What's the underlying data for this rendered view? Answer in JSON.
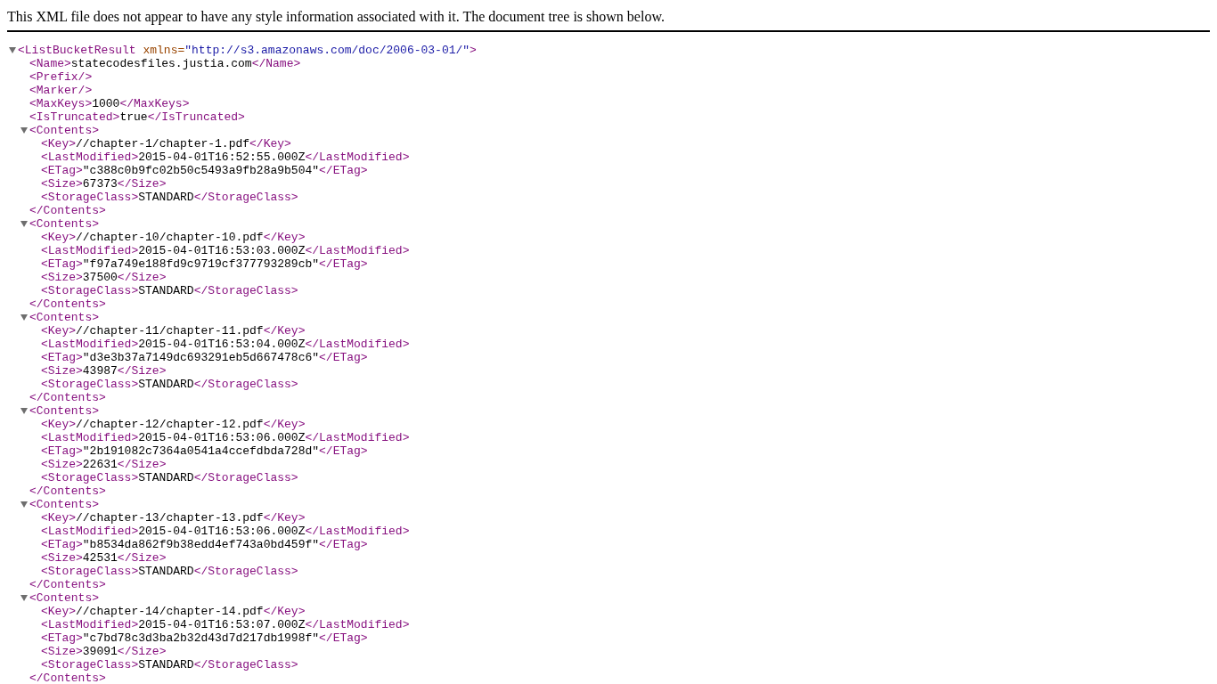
{
  "notice": "This XML file does not appear to have any style information associated with it. The document tree is shown below.",
  "tree": {
    "open": "<ListBucketResult",
    "attribute": {
      "name": "xmlns=",
      "value": "\"http://s3.amazonaws.com/doc/2006-03-01/\""
    },
    "open_end": ">",
    "expanded": true,
    "children": [
      {
        "open": "<Name>",
        "text": "statecodesfiles.justia.com",
        "close": "</Name>"
      },
      {
        "open": "<Prefix/>"
      },
      {
        "open": "<Marker/>"
      },
      {
        "open": "<MaxKeys>",
        "text": "1000",
        "close": "</MaxKeys>"
      },
      {
        "open": "<IsTruncated>",
        "text": "true",
        "close": "</IsTruncated>"
      },
      {
        "open": "<Contents>",
        "expanded": true,
        "close": "</Contents>",
        "children": [
          {
            "open": "<Key>",
            "text": "//chapter-1/chapter-1.pdf",
            "close": "</Key>"
          },
          {
            "open": "<LastModified>",
            "text": "2015-04-01T16:52:55.000Z",
            "close": "</LastModified>"
          },
          {
            "open": "<ETag>",
            "text": "\"c388c0b9fc02b50c5493a9fb28a9b504\"",
            "close": "</ETag>"
          },
          {
            "open": "<Size>",
            "text": "67373",
            "close": "</Size>"
          },
          {
            "open": "<StorageClass>",
            "text": "STANDARD",
            "close": "</StorageClass>"
          }
        ]
      },
      {
        "open": "<Contents>",
        "expanded": true,
        "close": "</Contents>",
        "children": [
          {
            "open": "<Key>",
            "text": "//chapter-10/chapter-10.pdf",
            "close": "</Key>"
          },
          {
            "open": "<LastModified>",
            "text": "2015-04-01T16:53:03.000Z",
            "close": "</LastModified>"
          },
          {
            "open": "<ETag>",
            "text": "\"f97a749e188fd9c9719cf377793289cb\"",
            "close": "</ETag>"
          },
          {
            "open": "<Size>",
            "text": "37500",
            "close": "</Size>"
          },
          {
            "open": "<StorageClass>",
            "text": "STANDARD",
            "close": "</StorageClass>"
          }
        ]
      },
      {
        "open": "<Contents>",
        "expanded": true,
        "close": "</Contents>",
        "children": [
          {
            "open": "<Key>",
            "text": "//chapter-11/chapter-11.pdf",
            "close": "</Key>"
          },
          {
            "open": "<LastModified>",
            "text": "2015-04-01T16:53:04.000Z",
            "close": "</LastModified>"
          },
          {
            "open": "<ETag>",
            "text": "\"d3e3b37a7149dc693291eb5d667478c6\"",
            "close": "</ETag>"
          },
          {
            "open": "<Size>",
            "text": "43987",
            "close": "</Size>"
          },
          {
            "open": "<StorageClass>",
            "text": "STANDARD",
            "close": "</StorageClass>"
          }
        ]
      },
      {
        "open": "<Contents>",
        "expanded": true,
        "close": "</Contents>",
        "children": [
          {
            "open": "<Key>",
            "text": "//chapter-12/chapter-12.pdf",
            "close": "</Key>"
          },
          {
            "open": "<LastModified>",
            "text": "2015-04-01T16:53:06.000Z",
            "close": "</LastModified>"
          },
          {
            "open": "<ETag>",
            "text": "\"2b191082c7364a0541a4ccefdbda728d\"",
            "close": "</ETag>"
          },
          {
            "open": "<Size>",
            "text": "22631",
            "close": "</Size>"
          },
          {
            "open": "<StorageClass>",
            "text": "STANDARD",
            "close": "</StorageClass>"
          }
        ]
      },
      {
        "open": "<Contents>",
        "expanded": true,
        "close": "</Contents>",
        "children": [
          {
            "open": "<Key>",
            "text": "//chapter-13/chapter-13.pdf",
            "close": "</Key>"
          },
          {
            "open": "<LastModified>",
            "text": "2015-04-01T16:53:06.000Z",
            "close": "</LastModified>"
          },
          {
            "open": "<ETag>",
            "text": "\"b8534da862f9b38edd4ef743a0bd459f\"",
            "close": "</ETag>"
          },
          {
            "open": "<Size>",
            "text": "42531",
            "close": "</Size>"
          },
          {
            "open": "<StorageClass>",
            "text": "STANDARD",
            "close": "</StorageClass>"
          }
        ]
      },
      {
        "open": "<Contents>",
        "expanded": true,
        "close": "</Contents>",
        "children": [
          {
            "open": "<Key>",
            "text": "//chapter-14/chapter-14.pdf",
            "close": "</Key>"
          },
          {
            "open": "<LastModified>",
            "text": "2015-04-01T16:53:07.000Z",
            "close": "</LastModified>"
          },
          {
            "open": "<ETag>",
            "text": "\"c7bd78c3d3ba2b32d43d7d217db1998f\"",
            "close": "</ETag>"
          },
          {
            "open": "<Size>",
            "text": "39091",
            "close": "</Size>"
          },
          {
            "open": "<StorageClass>",
            "text": "STANDARD",
            "close": "</StorageClass>"
          }
        ]
      }
    ]
  }
}
